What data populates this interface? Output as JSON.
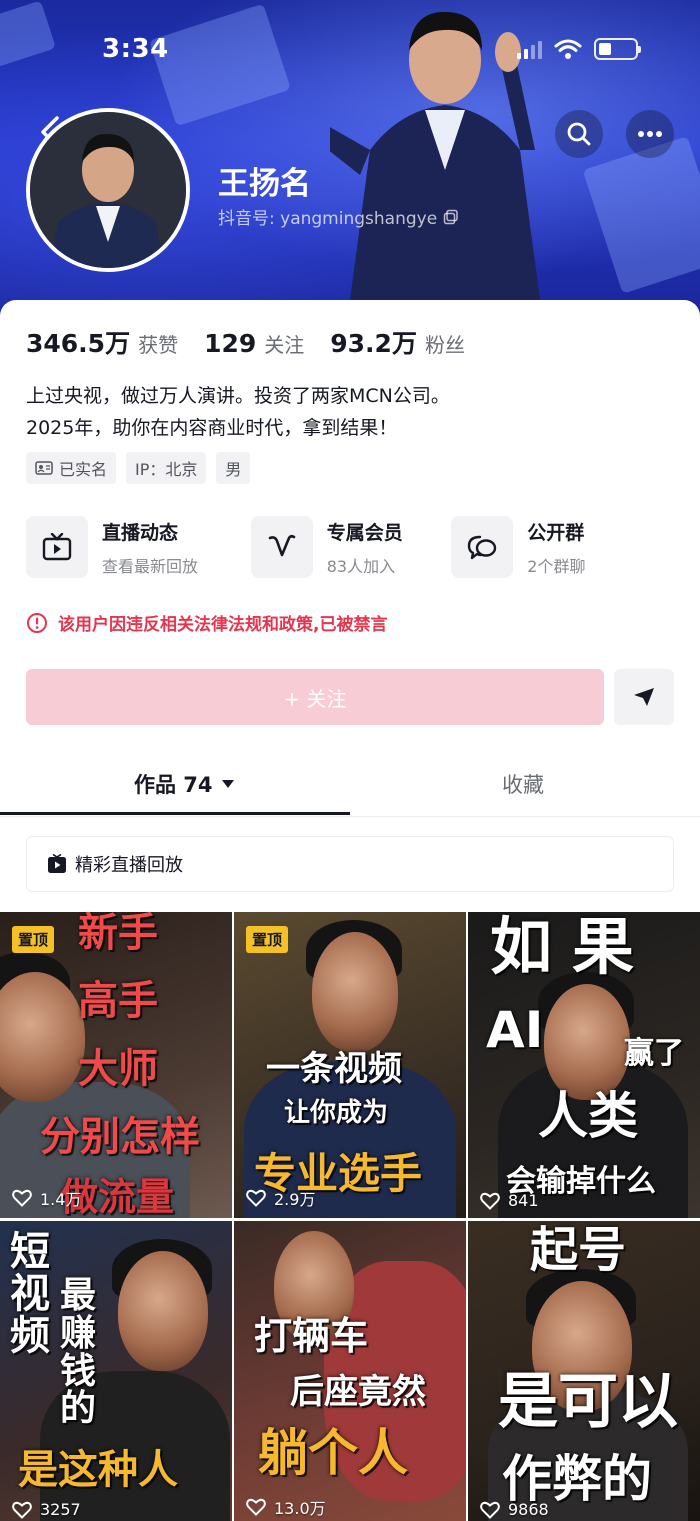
{
  "status_bar": {
    "time": "3:34",
    "battery_level": 0.35
  },
  "profile": {
    "nickname": "王扬名",
    "douyin_id": "抖音号: yangmingshangye",
    "stats": [
      {
        "value": "346.5万",
        "label": "获赞"
      },
      {
        "value": "129",
        "label": "关注"
      },
      {
        "value": "93.2万",
        "label": "粉丝"
      }
    ],
    "bio_line1": "上过央视，做过万人演讲。投资了两家MCN公司。",
    "bio_line2": "2025年，助你在内容商业时代，拿到结果！",
    "tags": {
      "verified": "已实名",
      "ip": "IP：北京",
      "gender": "男"
    }
  },
  "features": [
    {
      "title": "直播动态",
      "subtitle": "查看最新回放",
      "icon": "live-tv-icon"
    },
    {
      "title": "专属会员",
      "subtitle": "83人加入",
      "icon": "membership-v-icon"
    },
    {
      "title": "公开群",
      "subtitle": "2个群聊",
      "icon": "group-chat-icon"
    }
  ],
  "warning": "该用户因违反相关法律法规和政策,已被禁言",
  "actions": {
    "follow": "+ 关注"
  },
  "tabs": {
    "works": "作品 74",
    "favorites": "收藏"
  },
  "live_replay": "精彩直播回放",
  "videos": [
    {
      "pinned": "置顶",
      "likes": "1.4万",
      "caption": [
        "新手",
        "高手",
        "大师",
        "分别怎样",
        "做流量"
      ]
    },
    {
      "pinned": "置顶",
      "likes": "2.9万",
      "caption": [
        "一条视频",
        "让你成为",
        "专业选手"
      ]
    },
    {
      "pinned": "",
      "likes": "841",
      "caption": [
        "如果",
        "AI",
        "赢了",
        "人类",
        "会输掉什么"
      ]
    },
    {
      "pinned": "",
      "likes": "3257",
      "caption": [
        "短视频",
        "最赚钱的",
        "是这种人"
      ]
    },
    {
      "pinned": "",
      "likes": "13.0万",
      "caption": [
        "打辆车",
        "后座竟然",
        "躺个人"
      ]
    },
    {
      "pinned": "",
      "likes": "9868",
      "caption": [
        "起号",
        "是可以",
        "作弊的"
      ]
    }
  ],
  "colors": {
    "accent": "#fe2c55",
    "follow_disabled": "#f8ccd4",
    "warning": "#e5364f",
    "pinned": "#f4c227"
  }
}
